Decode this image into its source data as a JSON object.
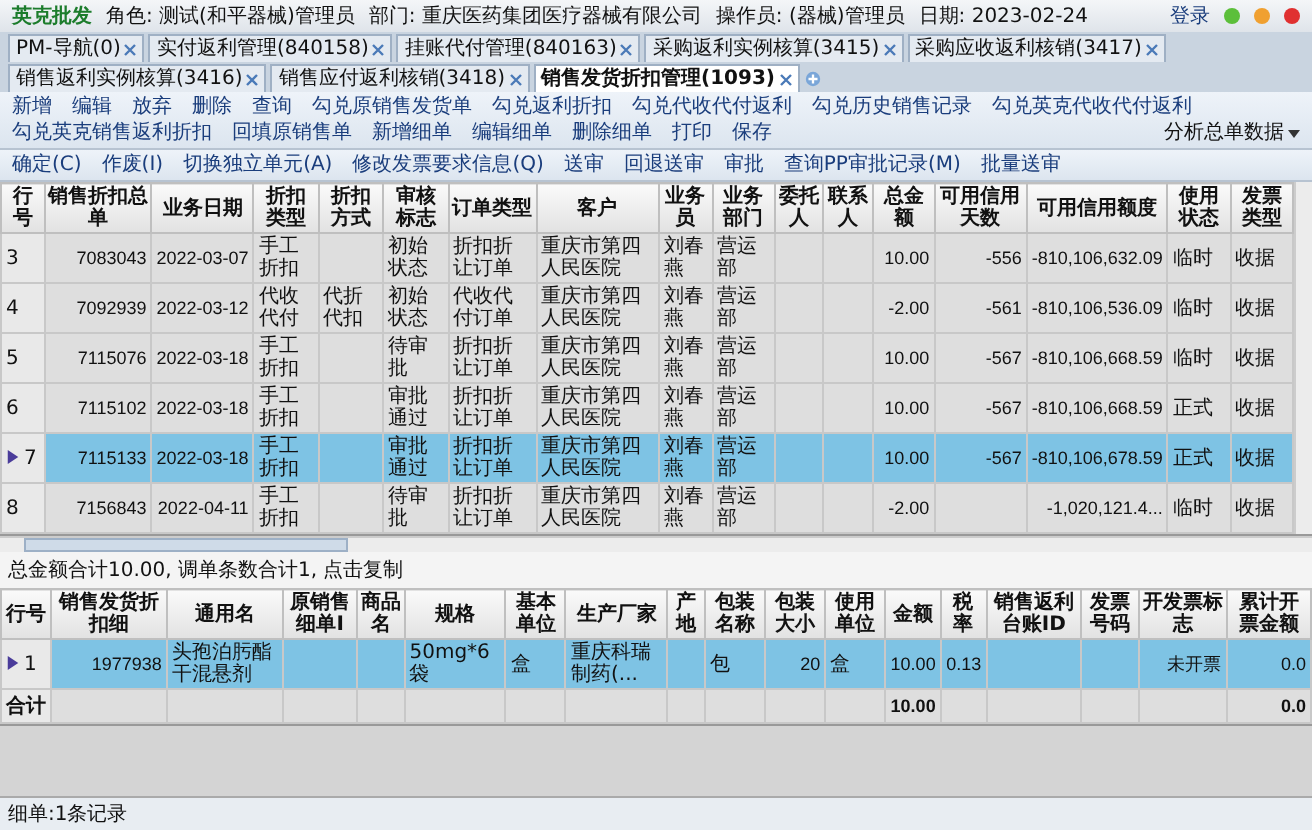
{
  "header": {
    "logo": "英克批发",
    "role": "角色: 测试(和平器械)管理员",
    "department": "部门: 重庆医药集团医疗器械有限公司",
    "operator": "操作员: (器械)管理员",
    "date": "日期: 2023-02-24",
    "login": "登录"
  },
  "tabs": [
    {
      "label": "PM-导航(0)",
      "selected": false
    },
    {
      "label": "实付返利管理(840158)",
      "selected": false
    },
    {
      "label": "挂账代付管理(840163)",
      "selected": false
    },
    {
      "label": "采购返利实例核算(3415)",
      "selected": false
    },
    {
      "label": "采购应收返利核销(3417)",
      "selected": false
    },
    {
      "label": "销售返利实例核算(3416)",
      "selected": false
    },
    {
      "label": "销售应付返利核销(3418)",
      "selected": false
    },
    {
      "label": "销售发货折扣管理(1093)",
      "selected": true
    }
  ],
  "toolbar_1": [
    {
      "label": "新增",
      "kind": "button"
    },
    {
      "label": "编辑",
      "kind": "button"
    },
    {
      "label": "放弃",
      "kind": "button"
    },
    {
      "label": "删除",
      "kind": "button"
    },
    {
      "label": "查询",
      "kind": "button"
    },
    {
      "label": "勾兑原销售发货单",
      "kind": "button"
    },
    {
      "label": "勾兑返利折扣",
      "kind": "button"
    },
    {
      "label": "勾兑代收代付返利",
      "kind": "button"
    },
    {
      "label": "勾兑历史销售记录",
      "kind": "button"
    },
    {
      "label": "勾兑英克代收代付返利",
      "kind": "button"
    },
    {
      "label": "勾兑英克销售返利折扣",
      "kind": "button"
    },
    {
      "label": "回填原销售单",
      "kind": "button"
    },
    {
      "label": "新增细单",
      "kind": "button"
    },
    {
      "label": "编辑细单",
      "kind": "button"
    },
    {
      "label": "删除细单",
      "kind": "button"
    },
    {
      "label": "打印",
      "kind": "button"
    },
    {
      "label": "保存",
      "kind": "button"
    },
    {
      "label": "分析总单数据",
      "kind": "dropdown"
    }
  ],
  "toolbar_2": [
    "确定(C)",
    "作废(I)",
    "切换独立单元(A)",
    "修改发票要求信息(Q)",
    "送审",
    "回退送审",
    "审批",
    "查询PP审批记录(M)",
    "批量送审"
  ],
  "main_table": {
    "columns": [
      {
        "label": "行号",
        "kind": "text"
      },
      {
        "label": "销售折扣总单",
        "kind": "number"
      },
      {
        "label": "业务日期",
        "kind": "number"
      },
      {
        "label": "折扣类型",
        "kind": "text"
      },
      {
        "label": "折扣方式",
        "kind": "text"
      },
      {
        "label": "审核标志",
        "kind": "text"
      },
      {
        "label": "订单类型",
        "kind": "text"
      },
      {
        "label": "客户",
        "kind": "text"
      },
      {
        "label": "业务员",
        "kind": "text"
      },
      {
        "label": "业务部门",
        "kind": "text"
      },
      {
        "label": "委托人",
        "kind": "text"
      },
      {
        "label": "联系人",
        "kind": "text"
      },
      {
        "label": "总金额",
        "kind": "number"
      },
      {
        "label": "可用信用天数",
        "kind": "number"
      },
      {
        "label": "可用信用额度",
        "kind": "number"
      },
      {
        "label": "使用状态",
        "kind": "text"
      },
      {
        "label": "发票类型",
        "kind": "text"
      }
    ],
    "rows": [
      {
        "selected": false,
        "current": false,
        "cells": [
          "3",
          "7083043",
          "2022-03-07",
          "手工折扣",
          "",
          "初始状态",
          "折扣折让订单",
          "重庆市第四人民医院",
          "刘春燕",
          "营运部",
          "",
          "",
          "10.00",
          "-556",
          "-810,106,632.09",
          "临时",
          "收据"
        ]
      },
      {
        "selected": false,
        "current": false,
        "cells": [
          "4",
          "7092939",
          "2022-03-12",
          "代收代付",
          "代折代扣",
          "初始状态",
          "代收代付订单",
          "重庆市第四人民医院",
          "刘春燕",
          "营运部",
          "",
          "",
          "-2.00",
          "-561",
          "-810,106,536.09",
          "临时",
          "收据"
        ]
      },
      {
        "selected": false,
        "current": false,
        "cells": [
          "5",
          "7115076",
          "2022-03-18",
          "手工折扣",
          "",
          "待审批",
          "折扣折让订单",
          "重庆市第四人民医院",
          "刘春燕",
          "营运部",
          "",
          "",
          "10.00",
          "-567",
          "-810,106,668.59",
          "临时",
          "收据"
        ]
      },
      {
        "selected": false,
        "current": false,
        "cells": [
          "6",
          "7115102",
          "2022-03-18",
          "手工折扣",
          "",
          "审批通过",
          "折扣折让订单",
          "重庆市第四人民医院",
          "刘春燕",
          "营运部",
          "",
          "",
          "10.00",
          "-567",
          "-810,106,668.59",
          "正式",
          "收据"
        ]
      },
      {
        "selected": true,
        "current": true,
        "cells": [
          "7",
          "7115133",
          "2022-03-18",
          "手工折扣",
          "",
          "审批通过",
          "折扣折让订单",
          "重庆市第四人民医院",
          "刘春燕",
          "营运部",
          "",
          "",
          "10.00",
          "-567",
          "-810,106,678.59",
          "正式",
          "收据"
        ]
      },
      {
        "selected": false,
        "current": false,
        "cells": [
          "8",
          "7156843",
          "2022-04-11",
          "手工折扣",
          "",
          "待审批",
          "折扣折让订单",
          "重庆市第四人民医院",
          "刘春燕",
          "营运部",
          "",
          "",
          "-2.00",
          "",
          "-1,020,121.4...",
          "临时",
          "收据"
        ]
      }
    ]
  },
  "summary": "总金额合计10.00, 调单条数合计1, 点击复制",
  "detail_table": {
    "columns": [
      {
        "label": "行号",
        "kind": "text"
      },
      {
        "label": "销售发货折扣细",
        "kind": "number"
      },
      {
        "label": "通用名",
        "kind": "text"
      },
      {
        "label": "原销售细单I",
        "kind": "text"
      },
      {
        "label": "商品名",
        "kind": "text"
      },
      {
        "label": "规格",
        "kind": "text"
      },
      {
        "label": "基本单位",
        "kind": "text"
      },
      {
        "label": "生产厂家",
        "kind": "text"
      },
      {
        "label": "产地",
        "kind": "text"
      },
      {
        "label": "包装名称",
        "kind": "text"
      },
      {
        "label": "包装大小",
        "kind": "number"
      },
      {
        "label": "使用单位",
        "kind": "text"
      },
      {
        "label": "金额",
        "kind": "number"
      },
      {
        "label": "税率",
        "kind": "number"
      },
      {
        "label": "销售返利台账ID",
        "kind": "text"
      },
      {
        "label": "发票号码",
        "kind": "text"
      },
      {
        "label": "开发票标志",
        "kind": "number"
      },
      {
        "label": "累计开票金额",
        "kind": "number"
      }
    ],
    "rows": [
      {
        "selected": true,
        "current": true,
        "cells": [
          "1",
          "1977938",
          "头孢泊肟酯干混悬剂",
          "",
          "",
          "50mg*6袋",
          "盒",
          "重庆科瑞制药(...",
          "",
          "包",
          "20",
          "盒",
          "10.00",
          "0.13",
          "",
          "",
          "未开票",
          "0.0"
        ]
      }
    ],
    "total": {
      "label": "合计",
      "cells": [
        "",
        "",
        "",
        "",
        "",
        "",
        "",
        "",
        "",
        "",
        "",
        "10.00",
        "",
        "",
        "",
        "",
        "0.0"
      ]
    }
  },
  "status_bar": "细单:1条记录"
}
